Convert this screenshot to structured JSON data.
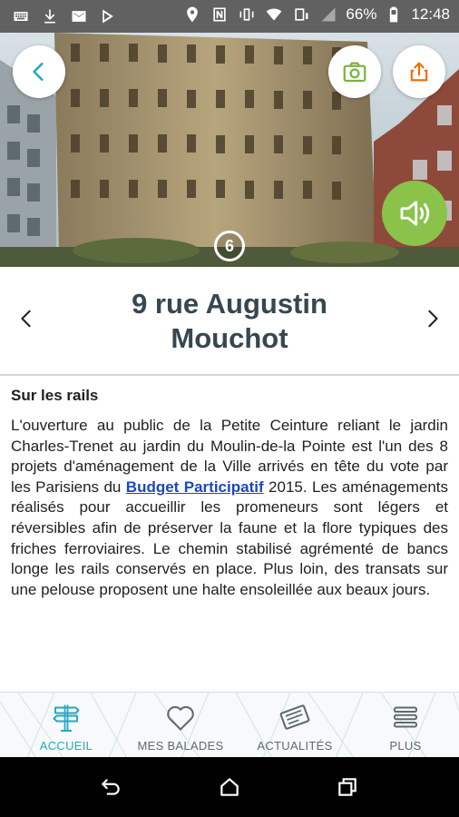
{
  "status_bar": {
    "battery_percent": "66%",
    "time": "12:48",
    "left_icons": [
      "keyboard-icon",
      "download-icon",
      "gmail-icon",
      "play-store-icon"
    ],
    "right_icons": [
      "location-icon",
      "nfc-icon",
      "vibrate-icon",
      "wifi-icon",
      "data-saver-icon",
      "signal-icon",
      "battery-icon"
    ]
  },
  "hero": {
    "stop_number": "6",
    "colors": {
      "audio_button": "#8bc34a",
      "camera_icon": "#7cb342",
      "share_icon": "#ef6c00",
      "back_icon": "#26a8c1"
    }
  },
  "place": {
    "title": "9 rue Augustin Mouchot"
  },
  "content": {
    "section_title": "Sur les rails",
    "paragraph_before_link": "L'ouverture au public de la Petite Ceinture reliant le jardin Charles-Trenet au jardin du Moulin-de-la Pointe est l'un des 8 projets d'aménagement de la Ville arrivés en tête du vote par les Parisiens du ",
    "link_text": "Budget Participatif",
    "paragraph_after_link": " 2015. Les aménagements réalisés pour accueillir les promeneurs sont légers et réversibles afin de préserver la faune et la flore typiques des friches ferroviaires. Le chemin stabilisé agrémenté de bancs longe les rails conservés en place. Plus loin, des transats sur une pelouse proposent une halte ensoleillée aux beaux jours."
  },
  "tabs": [
    {
      "label": "ACCUEIL",
      "icon": "signpost-icon",
      "active": true
    },
    {
      "label": "MES BALADES",
      "icon": "heart-icon",
      "active": false
    },
    {
      "label": "ACTUALITÉS",
      "icon": "newspaper-icon",
      "active": false
    },
    {
      "label": "PLUS",
      "icon": "menu-icon",
      "active": false
    }
  ],
  "colors": {
    "accent": "#26a8c1",
    "title": "#37474f",
    "link": "#1a49b8"
  }
}
